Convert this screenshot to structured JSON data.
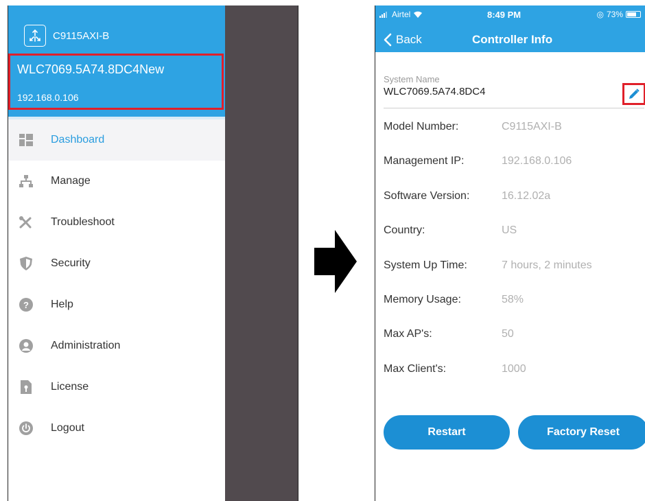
{
  "left_screen": {
    "app_model": "C9115AXI-B",
    "controller_name": "WLC7069.5A74.8DC4New",
    "controller_ip": "192.168.0.106",
    "menu": [
      {
        "label": "Dashboard",
        "icon": "dashboard-icon",
        "active": true
      },
      {
        "label": "Manage",
        "icon": "hierarchy-icon",
        "active": false
      },
      {
        "label": "Troubleshoot",
        "icon": "tools-icon",
        "active": false
      },
      {
        "label": "Security",
        "icon": "shield-icon",
        "active": false
      },
      {
        "label": "Help",
        "icon": "help-icon",
        "active": false
      },
      {
        "label": "Administration",
        "icon": "admin-user-icon",
        "active": false
      },
      {
        "label": "License",
        "icon": "license-file-icon",
        "active": false
      },
      {
        "label": "Logout",
        "icon": "power-icon",
        "active": false
      }
    ]
  },
  "right_screen": {
    "status": {
      "carrier": "Airtel",
      "time": "8:49 PM",
      "battery": "73%",
      "battery_level": 0.73
    },
    "nav": {
      "back": "Back",
      "title": "Controller Info"
    },
    "system_name_label": "System Name",
    "system_name_value": "WLC7069.5A74.8DC4",
    "info": [
      {
        "label": "Model Number:",
        "value": "C9115AXI-B"
      },
      {
        "label": "Management IP:",
        "value": "192.168.0.106"
      },
      {
        "label": "Software Version:",
        "value": "16.12.02a"
      },
      {
        "label": "Country:",
        "value": "US"
      },
      {
        "label": "System Up Time:",
        "value": "7 hours, 2 minutes"
      },
      {
        "label": "Memory Usage:",
        "value": "58%"
      },
      {
        "label": "Max AP's:",
        "value": "50"
      },
      {
        "label": "Max Client's:",
        "value": "1000"
      }
    ],
    "buttons": {
      "restart": "Restart",
      "factory_reset": "Factory Reset"
    }
  },
  "colors": {
    "accent": "#2ea3e3",
    "button": "#1c8fd4",
    "highlight": "#e0202a",
    "scrim": "#514a4e"
  }
}
